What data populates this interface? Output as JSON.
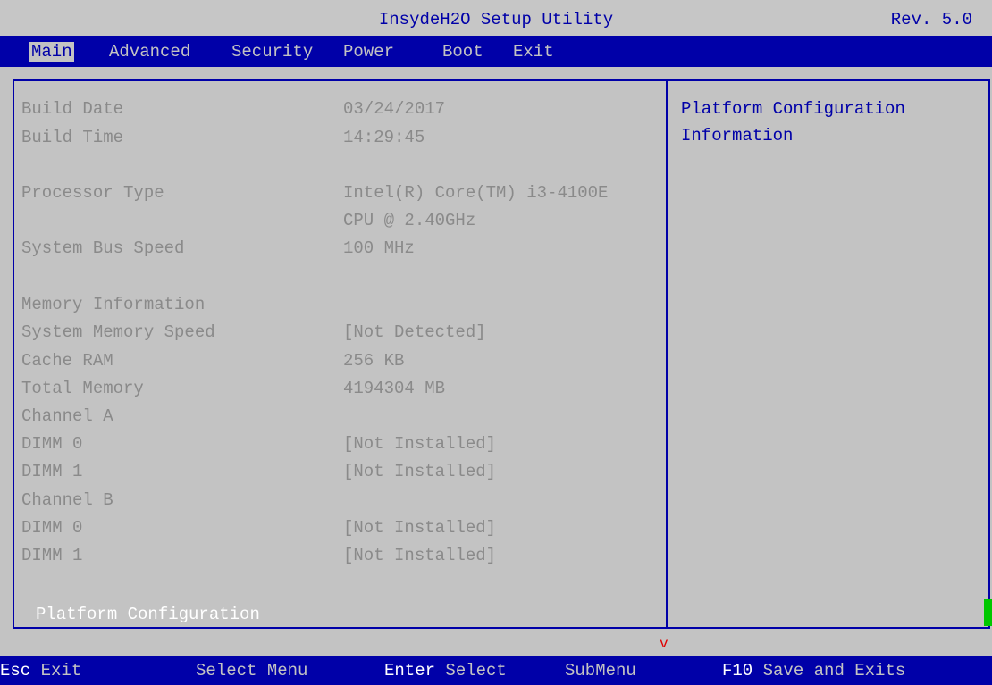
{
  "window": {
    "title": "InsydeH2O Setup Utility",
    "revision": "Rev. 5.0"
  },
  "menu": {
    "items": [
      "Main",
      "Advanced",
      "Security",
      "Power",
      "Boot",
      "Exit"
    ],
    "active": "Main"
  },
  "info": {
    "build_date": {
      "label": "Build Date",
      "value": "03/24/2017"
    },
    "build_time": {
      "label": "Build Time",
      "value": "14:29:45"
    },
    "processor_type": {
      "label": "Processor Type",
      "value_line1": "Intel(R) Core(TM) i3-4100E",
      "value_line2": "CPU @ 2.40GHz"
    },
    "system_bus_speed": {
      "label": "System Bus Speed",
      "value": "100 MHz"
    },
    "memory_information": {
      "label": "Memory Information"
    },
    "system_memory_speed": {
      "label": "System Memory Speed",
      "value": "[Not Detected]"
    },
    "cache_ram": {
      "label": "Cache RAM",
      "value": "256 KB"
    },
    "total_memory": {
      "label": "Total Memory",
      "value": "4194304 MB"
    },
    "channel_a": {
      "label": "Channel A"
    },
    "channel_a_dimm0": {
      "label": "DIMM 0",
      "value": "[Not Installed]"
    },
    "channel_a_dimm1": {
      "label": "DIMM 1",
      "value": "[Not Installed]"
    },
    "channel_b": {
      "label": "Channel B"
    },
    "channel_b_dimm0": {
      "label": "DIMM 0",
      "value": "[Not Installed]"
    },
    "channel_b_dimm1": {
      "label": "DIMM 1",
      "value": "[Not Installed]"
    },
    "platform_configuration": "Platform Configuration"
  },
  "help": {
    "line1": "Platform Configuration",
    "line2": "Information"
  },
  "scroll": {
    "arrow": "v"
  },
  "status": {
    "esc_key": "Esc",
    "esc_action": "Exit",
    "select_menu": "Select Menu",
    "enter_key": "Enter",
    "enter_action": "Select",
    "submenu": "SubMenu",
    "f10_key": "F10",
    "f10_action": "Save and Exits"
  },
  "colors": {
    "background": "#c3c3c3",
    "accent_blue": "#0000a8",
    "dim_text": "#8a8a8a",
    "highlight": "#ffffff",
    "scroll_arrow": "#e00000",
    "scroll_thumb": "#00c800"
  }
}
